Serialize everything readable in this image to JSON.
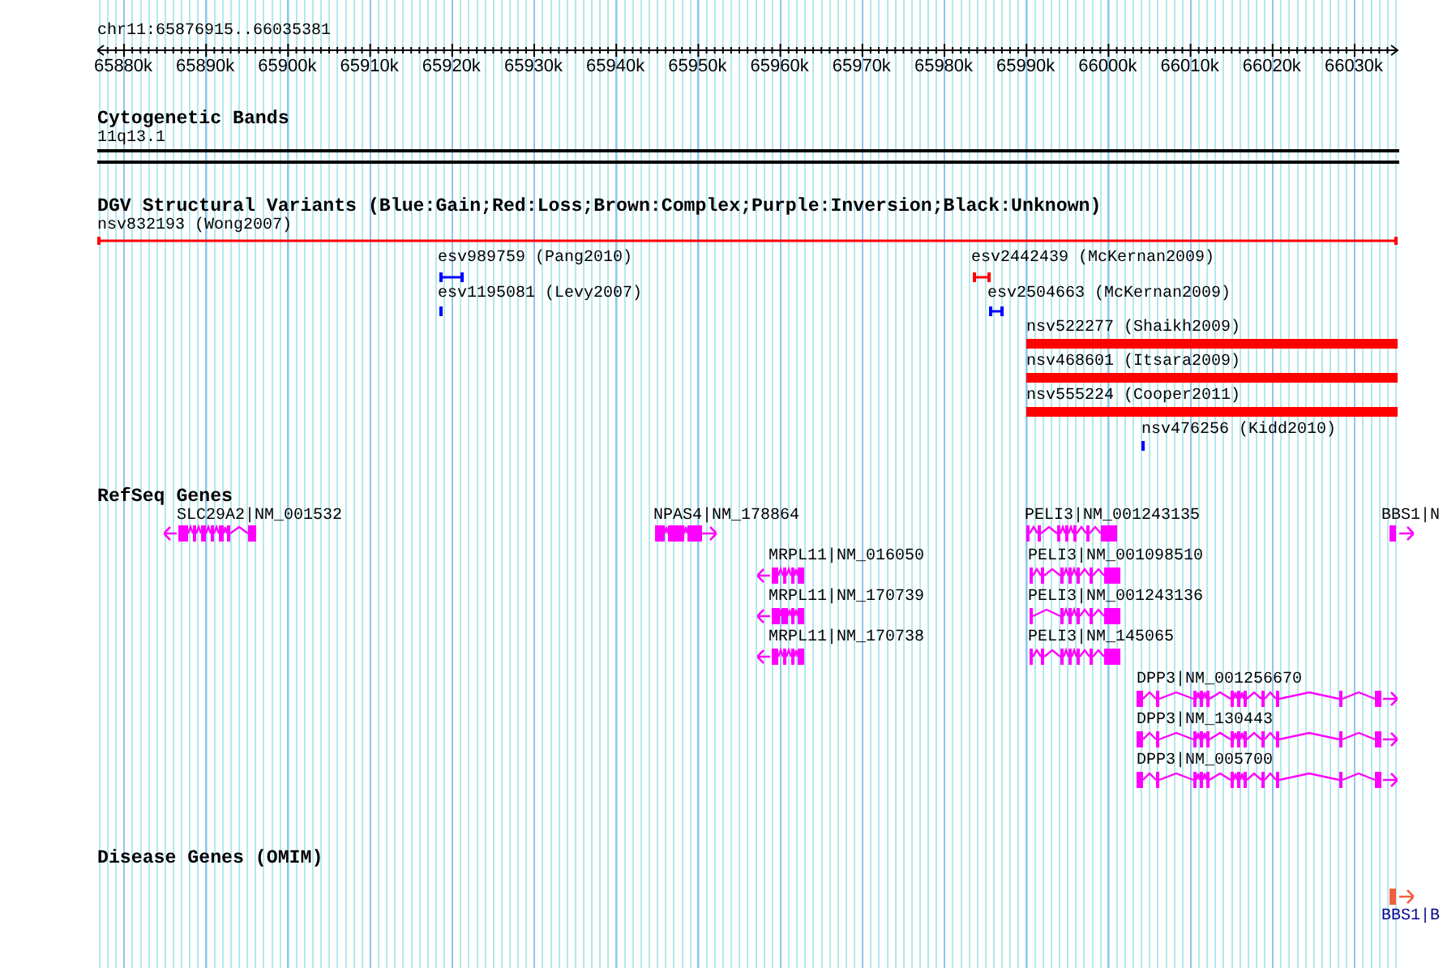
{
  "ruler": {
    "location": "chr11:65876915..66035381",
    "tick_labels": [
      "65880k",
      "65890k",
      "65900k",
      "65910k",
      "65920k",
      "65930k",
      "65940k",
      "65950k",
      "65960k",
      "65970k",
      "65980k",
      "65990k",
      "66000k",
      "66010k",
      "66020k",
      "66030k"
    ]
  },
  "cytogenetic_bands": {
    "title": "Cytogenetic Bands",
    "band": "11q13.1"
  },
  "dgv_structural_variants": {
    "title": "DGV Structural Variants (Blue:Gain;Red:Loss;Brown:Complex;Purple:Inversion;Black:Unknown)",
    "items": [
      {
        "label": "nsv832193 (Wong2007)",
        "color": "#ff0000"
      },
      {
        "label": "esv989759 (Pang2010)",
        "color": "#0000ff"
      },
      {
        "label": "esv2442439 (McKernan2009)",
        "color": "#ff0000"
      },
      {
        "label": "esv1195081 (Levy2007)",
        "color": "#0000ff"
      },
      {
        "label": "esv2504663 (McKernan2009)",
        "color": "#0000ff"
      },
      {
        "label": "nsv522277 (Shaikh2009)",
        "color": "#ff0000"
      },
      {
        "label": "nsv468601 (Itsara2009)",
        "color": "#ff0000"
      },
      {
        "label": "nsv555224 (Cooper2011)",
        "color": "#ff0000"
      },
      {
        "label": "nsv476256 (Kidd2010)",
        "color": "#0000ff"
      }
    ]
  },
  "refseq_genes": {
    "title": "RefSeq Genes",
    "items": [
      {
        "label": "SLC29A2|NM_001532",
        "kind": "reverse"
      },
      {
        "label": "NPAS4|NM_178864",
        "kind": "forward"
      },
      {
        "label": "MRPL11|NM_016050",
        "kind": "reverse"
      },
      {
        "label": "MRPL11|NM_170739",
        "kind": "reverse"
      },
      {
        "label": "MRPL11|NM_170738",
        "kind": "reverse"
      },
      {
        "label": "PELI3|NM_001243135",
        "kind": "plain"
      },
      {
        "label": "PELI3|NM_001098510",
        "kind": "plain"
      },
      {
        "label": "PELI3|NM_001243136",
        "kind": "plain"
      },
      {
        "label": "PELI3|NM_145065",
        "kind": "plain"
      },
      {
        "label": "DPP3|NM_001256670",
        "kind": "forward"
      },
      {
        "label": "DPP3|NM_130443",
        "kind": "forward"
      },
      {
        "label": "DPP3|NM_005700",
        "kind": "forward"
      },
      {
        "label": "BBS1|N",
        "kind": "forward"
      }
    ]
  },
  "disease_genes_omim": {
    "title": "Disease Genes (OMIM)",
    "items": [
      {
        "label": "BBS1|B",
        "kind": "forward"
      }
    ]
  }
}
